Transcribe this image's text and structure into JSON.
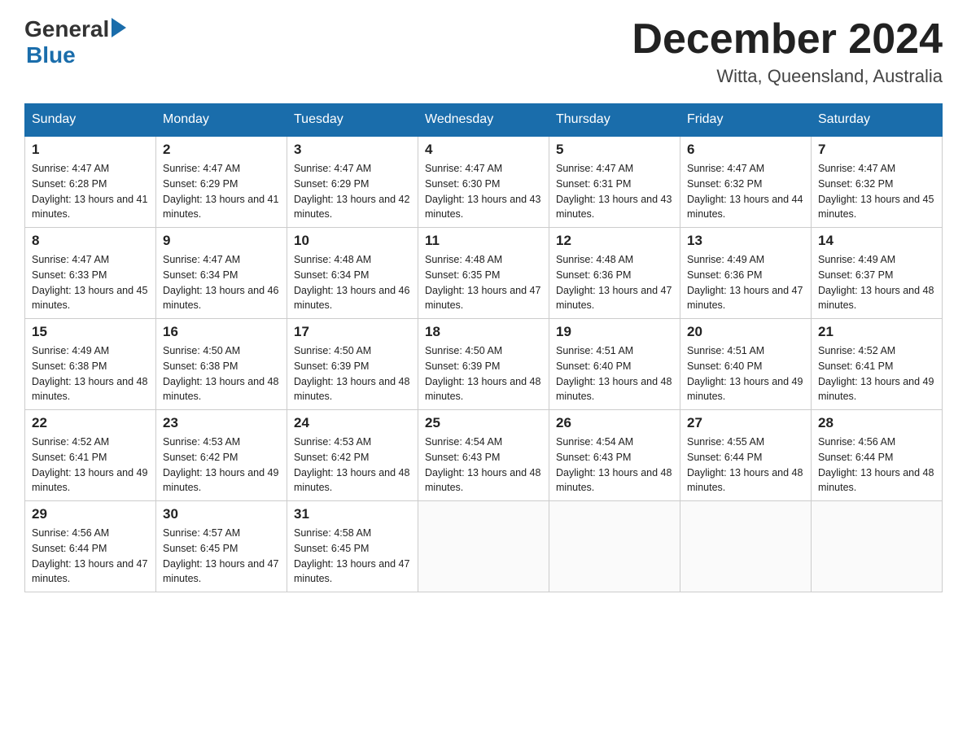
{
  "header": {
    "logo_general": "General",
    "logo_blue": "Blue",
    "title": "December 2024",
    "subtitle": "Witta, Queensland, Australia"
  },
  "days_of_week": [
    "Sunday",
    "Monday",
    "Tuesday",
    "Wednesday",
    "Thursday",
    "Friday",
    "Saturday"
  ],
  "weeks": [
    [
      {
        "day": 1,
        "sunrise": "4:47 AM",
        "sunset": "6:28 PM",
        "daylight": "13 hours and 41 minutes."
      },
      {
        "day": 2,
        "sunrise": "4:47 AM",
        "sunset": "6:29 PM",
        "daylight": "13 hours and 41 minutes."
      },
      {
        "day": 3,
        "sunrise": "4:47 AM",
        "sunset": "6:29 PM",
        "daylight": "13 hours and 42 minutes."
      },
      {
        "day": 4,
        "sunrise": "4:47 AM",
        "sunset": "6:30 PM",
        "daylight": "13 hours and 43 minutes."
      },
      {
        "day": 5,
        "sunrise": "4:47 AM",
        "sunset": "6:31 PM",
        "daylight": "13 hours and 43 minutes."
      },
      {
        "day": 6,
        "sunrise": "4:47 AM",
        "sunset": "6:32 PM",
        "daylight": "13 hours and 44 minutes."
      },
      {
        "day": 7,
        "sunrise": "4:47 AM",
        "sunset": "6:32 PM",
        "daylight": "13 hours and 45 minutes."
      }
    ],
    [
      {
        "day": 8,
        "sunrise": "4:47 AM",
        "sunset": "6:33 PM",
        "daylight": "13 hours and 45 minutes."
      },
      {
        "day": 9,
        "sunrise": "4:47 AM",
        "sunset": "6:34 PM",
        "daylight": "13 hours and 46 minutes."
      },
      {
        "day": 10,
        "sunrise": "4:48 AM",
        "sunset": "6:34 PM",
        "daylight": "13 hours and 46 minutes."
      },
      {
        "day": 11,
        "sunrise": "4:48 AM",
        "sunset": "6:35 PM",
        "daylight": "13 hours and 47 minutes."
      },
      {
        "day": 12,
        "sunrise": "4:48 AM",
        "sunset": "6:36 PM",
        "daylight": "13 hours and 47 minutes."
      },
      {
        "day": 13,
        "sunrise": "4:49 AM",
        "sunset": "6:36 PM",
        "daylight": "13 hours and 47 minutes."
      },
      {
        "day": 14,
        "sunrise": "4:49 AM",
        "sunset": "6:37 PM",
        "daylight": "13 hours and 48 minutes."
      }
    ],
    [
      {
        "day": 15,
        "sunrise": "4:49 AM",
        "sunset": "6:38 PM",
        "daylight": "13 hours and 48 minutes."
      },
      {
        "day": 16,
        "sunrise": "4:50 AM",
        "sunset": "6:38 PM",
        "daylight": "13 hours and 48 minutes."
      },
      {
        "day": 17,
        "sunrise": "4:50 AM",
        "sunset": "6:39 PM",
        "daylight": "13 hours and 48 minutes."
      },
      {
        "day": 18,
        "sunrise": "4:50 AM",
        "sunset": "6:39 PM",
        "daylight": "13 hours and 48 minutes."
      },
      {
        "day": 19,
        "sunrise": "4:51 AM",
        "sunset": "6:40 PM",
        "daylight": "13 hours and 48 minutes."
      },
      {
        "day": 20,
        "sunrise": "4:51 AM",
        "sunset": "6:40 PM",
        "daylight": "13 hours and 49 minutes."
      },
      {
        "day": 21,
        "sunrise": "4:52 AM",
        "sunset": "6:41 PM",
        "daylight": "13 hours and 49 minutes."
      }
    ],
    [
      {
        "day": 22,
        "sunrise": "4:52 AM",
        "sunset": "6:41 PM",
        "daylight": "13 hours and 49 minutes."
      },
      {
        "day": 23,
        "sunrise": "4:53 AM",
        "sunset": "6:42 PM",
        "daylight": "13 hours and 49 minutes."
      },
      {
        "day": 24,
        "sunrise": "4:53 AM",
        "sunset": "6:42 PM",
        "daylight": "13 hours and 48 minutes."
      },
      {
        "day": 25,
        "sunrise": "4:54 AM",
        "sunset": "6:43 PM",
        "daylight": "13 hours and 48 minutes."
      },
      {
        "day": 26,
        "sunrise": "4:54 AM",
        "sunset": "6:43 PM",
        "daylight": "13 hours and 48 minutes."
      },
      {
        "day": 27,
        "sunrise": "4:55 AM",
        "sunset": "6:44 PM",
        "daylight": "13 hours and 48 minutes."
      },
      {
        "day": 28,
        "sunrise": "4:56 AM",
        "sunset": "6:44 PM",
        "daylight": "13 hours and 48 minutes."
      }
    ],
    [
      {
        "day": 29,
        "sunrise": "4:56 AM",
        "sunset": "6:44 PM",
        "daylight": "13 hours and 47 minutes."
      },
      {
        "day": 30,
        "sunrise": "4:57 AM",
        "sunset": "6:45 PM",
        "daylight": "13 hours and 47 minutes."
      },
      {
        "day": 31,
        "sunrise": "4:58 AM",
        "sunset": "6:45 PM",
        "daylight": "13 hours and 47 minutes."
      },
      null,
      null,
      null,
      null
    ]
  ]
}
